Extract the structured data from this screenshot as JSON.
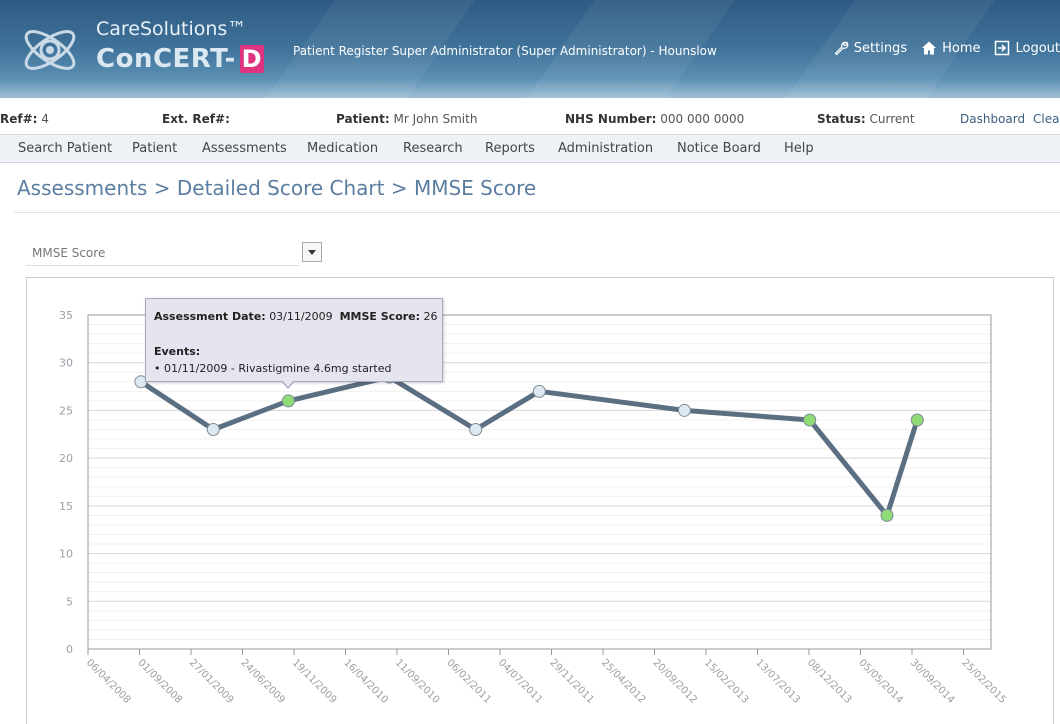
{
  "app": {
    "brand_top": "CareSolutions™",
    "brand_name": "ConCERT-",
    "brand_letter": "D",
    "user_title": "Patient Register Super Administrator (Super Administrator) - Hounslow",
    "links": [
      {
        "label": "Settings",
        "icon": "wrench-icon"
      },
      {
        "label": "Home",
        "icon": "home-icon"
      },
      {
        "label": "Logout",
        "icon": "logout-icon"
      }
    ]
  },
  "patient_bar": {
    "ref_label": "Ref#:",
    "ref_value": "4",
    "ext_ref_label": "Ext. Ref#:",
    "ext_ref_value": "",
    "patient_label": "Patient:",
    "patient_value": "Mr John Smith",
    "nhs_label": "NHS Number:",
    "nhs_value": "000 000 0000",
    "status_label": "Status:",
    "status_value": "Current",
    "dashboard_link": "Dashboard",
    "clear_link": "Clea"
  },
  "nav": {
    "items": [
      "Search Patient",
      "Patient",
      "Assessments",
      "Medication",
      "Research",
      "Reports",
      "Administration",
      "Notice Board",
      "Help"
    ]
  },
  "page": {
    "title": "Assessments > Detailed Score Chart > MMSE Score",
    "selector_value": "MMSE Score"
  },
  "tooltip": {
    "date_label": "Assessment Date:",
    "date_value": "03/11/2009",
    "score_label": "MMSE Score:",
    "score_value": "26",
    "events_label": "Events:",
    "event_text": "• 01/11/2009 - Rivastigmine 4.6mg started"
  },
  "colors": {
    "line": "#5b6f82",
    "marker_plain": "#dde8f3",
    "marker_event": "#8fdc76",
    "axis_label": "#9aa0a6"
  },
  "chart_data": {
    "type": "line",
    "title": "",
    "xlabel": "",
    "ylabel": "",
    "ylim": [
      0,
      35
    ],
    "yticks": [
      0,
      5,
      10,
      15,
      20,
      25,
      30,
      35
    ],
    "xlim": [
      "2008-04-06",
      "2015-05-15"
    ],
    "xtick_labels": [
      "06/04/2008",
      "01/09/2008",
      "27/01/2009",
      "24/06/2009",
      "19/11/2009",
      "16/04/2010",
      "11/09/2010",
      "06/02/2011",
      "04/07/2011",
      "29/11/2011",
      "25/04/2012",
      "20/09/2012",
      "15/02/2013",
      "13/07/2013",
      "08/12/2013",
      "05/05/2014",
      "30/09/2014",
      "25/02/2015"
    ],
    "xtick_dates": [
      "2008-04-06",
      "2008-09-01",
      "2009-01-27",
      "2009-06-24",
      "2009-11-19",
      "2010-04-16",
      "2010-09-11",
      "2011-02-06",
      "2011-07-04",
      "2011-11-29",
      "2012-04-25",
      "2012-09-20",
      "2013-02-15",
      "2013-07-13",
      "2013-12-08",
      "2014-05-05",
      "2014-09-30",
      "2015-02-25"
    ],
    "grid": true,
    "series": [
      {
        "points": [
          {
            "date": "2008-09-05",
            "value": 28,
            "event": false
          },
          {
            "date": "2009-04-01",
            "value": 23,
            "event": false
          },
          {
            "date": "2009-11-03",
            "value": 26,
            "event": true
          },
          {
            "date": "2010-08-20",
            "value": 28.5,
            "event": false
          },
          {
            "date": "2011-04-25",
            "value": 23,
            "event": false
          },
          {
            "date": "2011-10-25",
            "value": 27,
            "event": false
          },
          {
            "date": "2012-12-15",
            "value": 25,
            "event": false
          },
          {
            "date": "2013-12-10",
            "value": 24,
            "event": true
          },
          {
            "date": "2014-07-20",
            "value": 14,
            "event": true
          },
          {
            "date": "2014-10-15",
            "value": 24,
            "event": true
          }
        ]
      }
    ]
  }
}
